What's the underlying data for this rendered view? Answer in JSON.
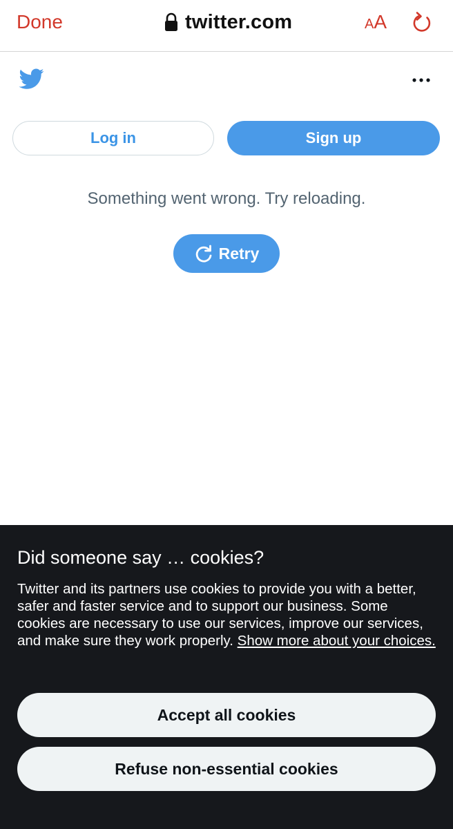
{
  "browser": {
    "done_label": "Done",
    "url": "twitter.com",
    "text_size_small": "A",
    "text_size_large": "A",
    "accent_color": "#d2382a"
  },
  "header": {
    "logo_icon": "twitter-bird-icon",
    "more_icon": "more-horizontal-icon",
    "brand_color": "#4a9ae8"
  },
  "auth": {
    "login_label": "Log in",
    "signup_label": "Sign up"
  },
  "error": {
    "message": "Something went wrong. Try reloading.",
    "retry_label": "Retry"
  },
  "cookies": {
    "title": "Did someone say … cookies?",
    "body": "Twitter and its partners use cookies to provide you with a better, safer and faster service and to support our business. Some cookies are necessary to use our services, improve our services, and make sure they work properly.",
    "link_text": "Show more about your choices.",
    "accept_label": "Accept all cookies",
    "refuse_label": "Refuse non-essential cookies",
    "background_color": "#16181c"
  }
}
